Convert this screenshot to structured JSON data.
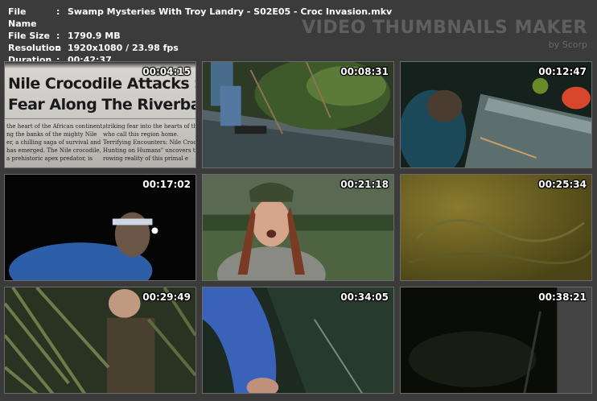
{
  "info": {
    "file_name_label": "File Name",
    "file_name_value": "Swamp Mysteries With Troy Landry - S02E05 - Croc Invasion.mkv",
    "file_size_label": "File Size",
    "file_size_value": "1790.9 MB",
    "resolution_label": "Resolution",
    "resolution_value": "1920x1080 / 23.98 fps",
    "duration_label": "Duration",
    "duration_value": "00:42:37",
    "separator": ":"
  },
  "brand": {
    "title": "VIDEO THUMBNAILS MAKER",
    "byline": "by Scorp"
  },
  "newspaper": {
    "headline_1": "Nile Crocodile Attacks Strik",
    "headline_2": "Fear Along The Riverbanks",
    "col1": [
      "the heart of the African continent,",
      "ng the banks of the mighty Nile",
      "er, a chilling saga of survival and",
      "has emerged. The Nile crocodile,",
      "a prehistoric apex predator, is"
    ],
    "col2": [
      "striking fear into the hearts of th",
      "who call this region home.",
      "Terrifying Encounters: Nile Crocs f",
      "Hunting on Humans\" uncovers the",
      "rowing reality of this primal e"
    ]
  },
  "thumbnails": [
    {
      "time": "00:04:15"
    },
    {
      "time": "00:08:31"
    },
    {
      "time": "00:12:47"
    },
    {
      "time": "00:17:02"
    },
    {
      "time": "00:21:18"
    },
    {
      "time": "00:25:34"
    },
    {
      "time": "00:29:49"
    },
    {
      "time": "00:34:05"
    },
    {
      "time": "00:38:21"
    }
  ],
  "colors": {
    "background": "#3b3b3b",
    "text": "#ffffff",
    "brand": "#5f5f5f"
  }
}
